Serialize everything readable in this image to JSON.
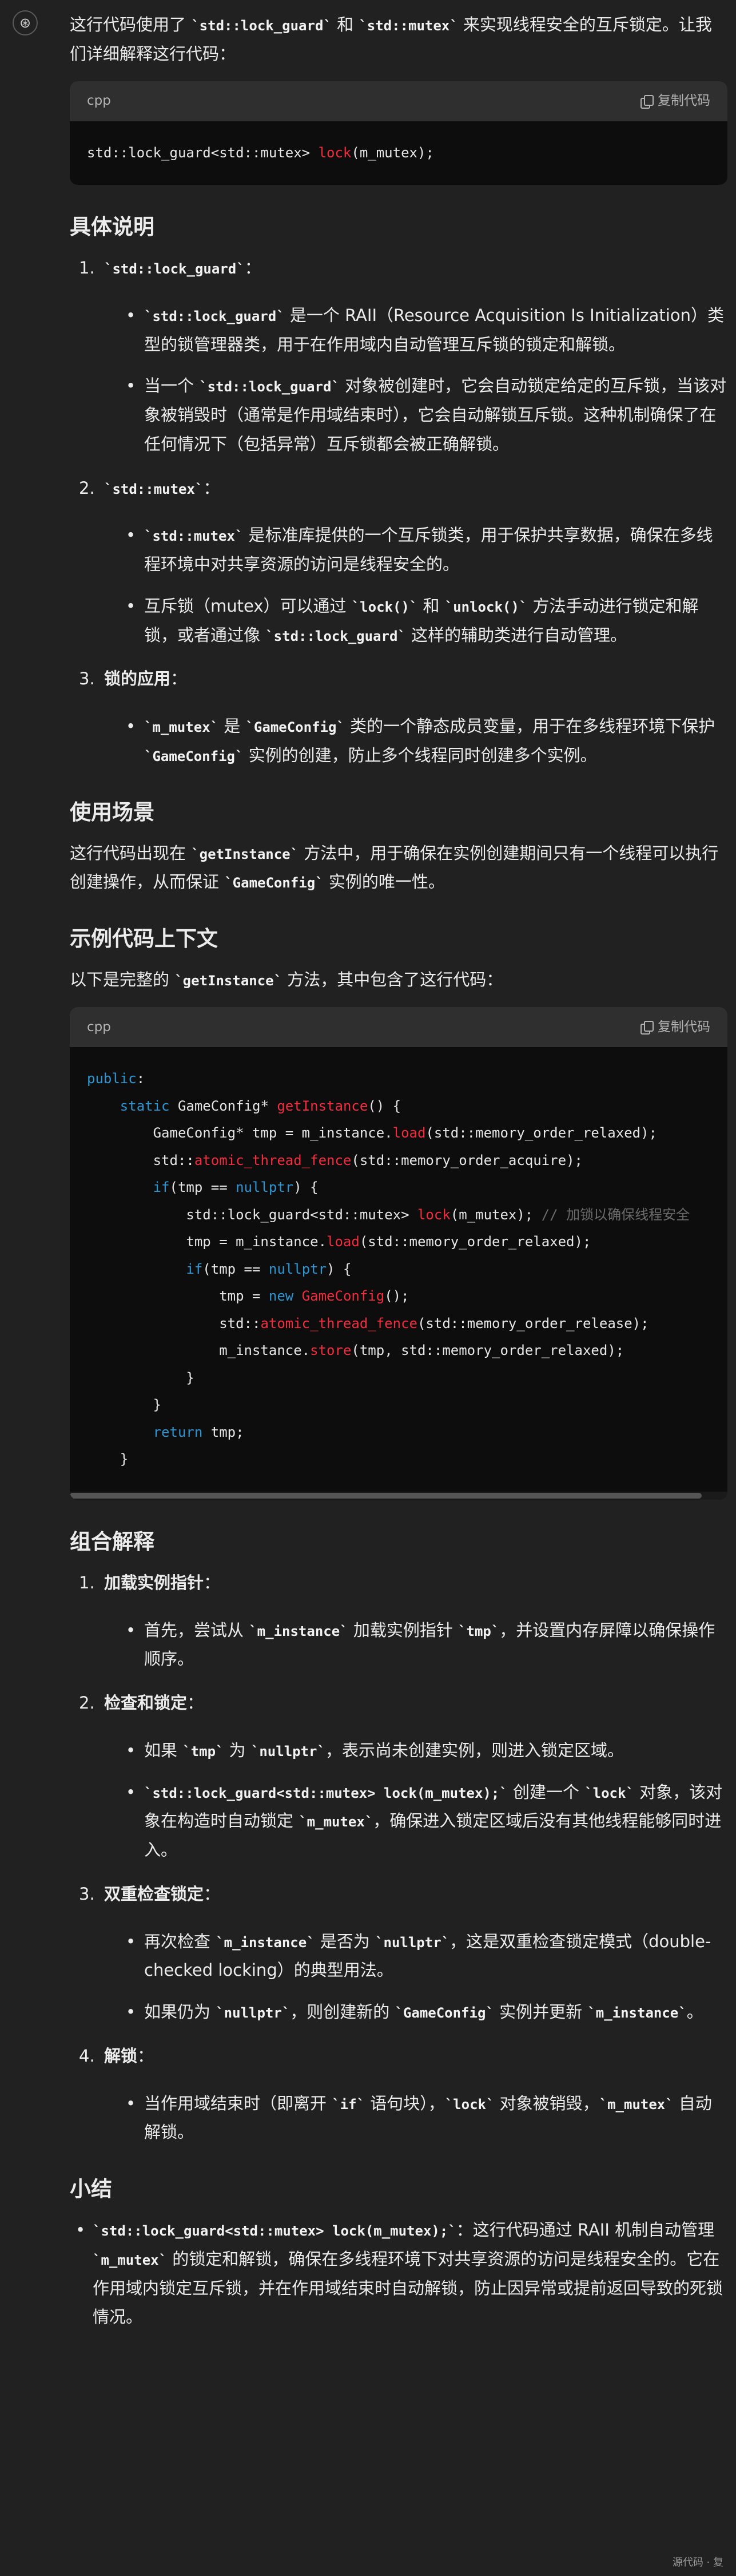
{
  "intro": {
    "pre": "这行代码使用了 ",
    "c1": "`std::lock_guard`",
    "mid": " 和 ",
    "c2": "`std::mutex`",
    "post": " 来实现线程安全的互斥锁定。让我们详细解释这行代码："
  },
  "code1": {
    "lang": "cpp",
    "copy_label": "复制代码"
  },
  "section1": {
    "heading": "具体说明",
    "items": [
      {
        "num": "1.",
        "title": "`std::lock_guard`",
        "colon": "：",
        "bullets": [
          {
            "c": "`std::lock_guard`",
            "t": " 是一个 RAII（Resource Acquisition Is Initialization）类型的锁管理器类，用于在作用域内自动管理互斥锁的锁定和解锁。"
          },
          {
            "p": "当一个 ",
            "c": "`std::lock_guard`",
            "t": " 对象被创建时，它会自动锁定给定的互斥锁，当该对象被销毁时（通常是作用域结束时），它会自动解锁互斥锁。这种机制确保了在任何情况下（包括异常）互斥锁都会被正确解锁。"
          }
        ]
      },
      {
        "num": "2.",
        "title": "`std::mutex`",
        "colon": "：",
        "bullets": [
          {
            "c": "`std::mutex`",
            "t": " 是标准库提供的一个互斥锁类，用于保护共享数据，确保在多线程环境中对共享资源的访问是线程安全的。"
          },
          {
            "p": "互斥锁（mutex）可以通过 ",
            "c": "`lock()`",
            "m": " 和 ",
            "c2": "`unlock()`",
            "m2": " 方法手动进行锁定和解锁，或者通过像 ",
            "c3": "`std::lock_guard`",
            "t": " 这样的辅助类进行自动管理。"
          }
        ]
      },
      {
        "num": "3.",
        "title": "锁的应用",
        "colon": "：",
        "bullets": [
          {
            "c": "`m_mutex`",
            "m": " 是 ",
            "c2": "`GameConfig`",
            "m2": " 类的一个静态成员变量，用于在多线程环境下保护 ",
            "c3": "`GameConfig`",
            "t": " 实例的创建，防止多个线程同时创建多个实例。"
          }
        ]
      }
    ]
  },
  "usage": {
    "heading": "使用场景",
    "pre": "这行代码出现在 ",
    "c1": "`getInstance`",
    "mid": " 方法中，用于确保在实例创建期间只有一个线程可以执行创建操作，从而保证 ",
    "c2": "`GameConfig`",
    "post": " 实例的唯一性。"
  },
  "example": {
    "heading": "示例代码上下文",
    "pre": "以下是完整的 ",
    "c1": "`getInstance`",
    "post": " 方法，其中包含了这行代码："
  },
  "code2": {
    "lang": "cpp",
    "copy_label": "复制代码"
  },
  "section2": {
    "heading": "组合解释",
    "items": [
      {
        "num": "1.",
        "title": "加载实例指针",
        "colon": "：",
        "bullets": [
          {
            "p": "首先，尝试从 ",
            "c": "`m_instance`",
            "m": " 加载实例指针 ",
            "c2": "`tmp`",
            "t": "，并设置内存屏障以确保操作顺序。"
          }
        ]
      },
      {
        "num": "2.",
        "title": "检查和锁定",
        "colon": "：",
        "bullets": [
          {
            "p": "如果 ",
            "c": "`tmp`",
            "m": " 为 ",
            "c2": "`nullptr`",
            "t": "，表示尚未创建实例，则进入锁定区域。"
          },
          {
            "c": "`std::lock_guard<std::mutex> lock(m_mutex);`",
            "m": " 创建一个 ",
            "c2": "`lock`",
            "m2": " 对象，该对象在构造时自动锁定 ",
            "c3": "`m_mutex`",
            "t": "，确保进入锁定区域后没有其他线程能够同时进入。"
          }
        ]
      },
      {
        "num": "3.",
        "title": "双重检查锁定",
        "colon": "：",
        "bullets": [
          {
            "p": "再次检查 ",
            "c": "`m_instance`",
            "m": " 是否为 ",
            "c2": "`nullptr`",
            "t": "，这是双重检查锁定模式（double-checked locking）的典型用法。"
          },
          {
            "p": "如果仍为 ",
            "c": "`nullptr`",
            "m": "，则创建新的 ",
            "c2": "`GameConfig`",
            "m2": " 实例并更新 ",
            "c3": "`m_instance`",
            "t": "。"
          }
        ]
      },
      {
        "num": "4.",
        "title": "解锁",
        "colon": "：",
        "bullets": [
          {
            "p": "当作用域结束时（即离开 ",
            "c": "`if`",
            "m": " 语句块），",
            "c2": "`lock`",
            "m2": " 对象被销毁，",
            "c3": "`m_mutex`",
            "t": " 自动解锁。"
          }
        ]
      }
    ]
  },
  "summary": {
    "heading": "小结",
    "c": "`std::lock_guard<std::mutex> lock(m_mutex);`",
    "m": "：这行代码通过 RAII 机制自动管理 ",
    "c2": "`m_mutex`",
    "t": " 的锁定和解锁，确保在多线程环境下对共享资源的访问是线程安全的。它在作用域内锁定互斥锁，并在作用域结束时自动解锁，防止因异常或提前返回导致的死锁情况。"
  },
  "footer": "源代码 · 复"
}
